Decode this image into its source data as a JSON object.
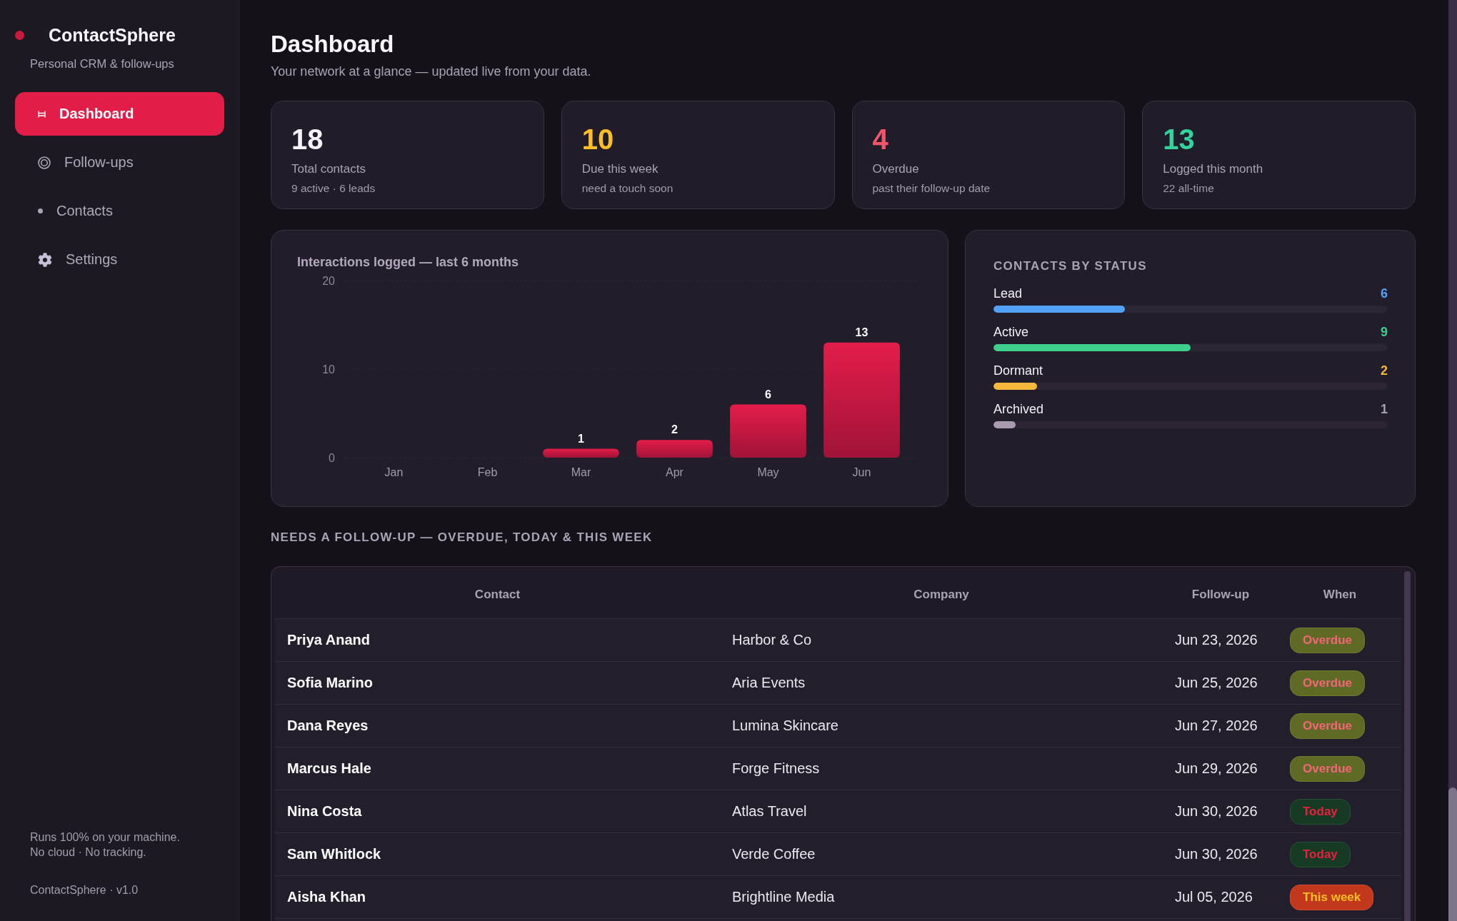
{
  "sidebar": {
    "brand": "ContactSphere",
    "tagline": "Personal CRM & follow-ups",
    "nav": [
      {
        "label": "Dashboard",
        "selected": true
      },
      {
        "label": "Follow-ups",
        "selected": false
      },
      {
        "label": "Contacts",
        "selected": false
      },
      {
        "label": "Settings",
        "selected": false
      }
    ],
    "footer_note": "Runs 100% on your machine.\nNo cloud · No tracking.",
    "version": "ContactSphere · v1.0"
  },
  "header": {
    "title": "Dashboard",
    "subtitle": "Your network at a glance — updated live from your data."
  },
  "stats": [
    {
      "value": "18",
      "label": "Total contacts",
      "detail": "9 active · 6 leads",
      "color": "#f6f3f9"
    },
    {
      "value": "10",
      "label": "Due this week",
      "detail": "need a touch soon",
      "color": "#fbbf24"
    },
    {
      "value": "4",
      "label": "Overdue",
      "detail": "past their follow-up date",
      "color": "#f0566a"
    },
    {
      "value": "13",
      "label": "Logged this month",
      "detail": "22 all-time",
      "color": "#34d399"
    }
  ],
  "interactions_panel": {
    "chart_data": {
      "type": "bar",
      "title": "Interactions logged — last 6 months",
      "categories": [
        "Jan",
        "Feb",
        "Mar",
        "Apr",
        "May",
        "Jun"
      ],
      "values": [
        0,
        0,
        1,
        2,
        6,
        13
      ],
      "ylim": [
        0,
        20
      ],
      "yticks": [
        0,
        10,
        20
      ],
      "value_labels": [
        null,
        null,
        "1",
        "2",
        "6",
        "13"
      ]
    }
  },
  "status_panel": {
    "title": "CONTACTS BY STATUS",
    "statuses": [
      {
        "label": "Lead",
        "value": "6",
        "level": 0.333,
        "color": "#52a3f7"
      },
      {
        "label": "Active",
        "value": "9",
        "level": 0.5,
        "color": "#3ecf8e"
      },
      {
        "label": "Dormant",
        "value": "2",
        "level": 0.111,
        "color": "#f5b83d"
      },
      {
        "label": "Archived",
        "value": "1",
        "level": 0.056,
        "color": "#a99bb0"
      }
    ]
  },
  "follow_ups": {
    "title": "NEEDS A FOLLOW-UP — OVERDUE, TODAY & THIS WEEK",
    "columns": [
      "Contact",
      "Company",
      "Follow-up",
      "When"
    ],
    "rows": [
      {
        "contact": "Priya Anand",
        "company": "Harbor & Co",
        "follow_up": "Jun 23, 2026",
        "when": {
          "label": "Overdue",
          "kind": "overdue"
        }
      },
      {
        "contact": "Sofia Marino",
        "company": "Aria Events",
        "follow_up": "Jun 25, 2026",
        "when": {
          "label": "Overdue",
          "kind": "overdue"
        }
      },
      {
        "contact": "Dana Reyes",
        "company": "Lumina Skincare",
        "follow_up": "Jun 27, 2026",
        "when": {
          "label": "Overdue",
          "kind": "overdue"
        }
      },
      {
        "contact": "Marcus Hale",
        "company": "Forge Fitness",
        "follow_up": "Jun 29, 2026",
        "when": {
          "label": "Overdue",
          "kind": "overdue"
        }
      },
      {
        "contact": "Nina Costa",
        "company": "Atlas Travel",
        "follow_up": "Jun 30, 2026",
        "when": {
          "label": "Today",
          "kind": "today"
        }
      },
      {
        "contact": "Sam Whitlock",
        "company": "Verde Coffee",
        "follow_up": "Jun 30, 2026",
        "when": {
          "label": "Today",
          "kind": "today"
        }
      },
      {
        "contact": "Aisha Khan",
        "company": "Brightline Media",
        "follow_up": "Jul 05, 2026",
        "when": {
          "label": "This week",
          "kind": "week"
        }
      }
    ]
  }
}
